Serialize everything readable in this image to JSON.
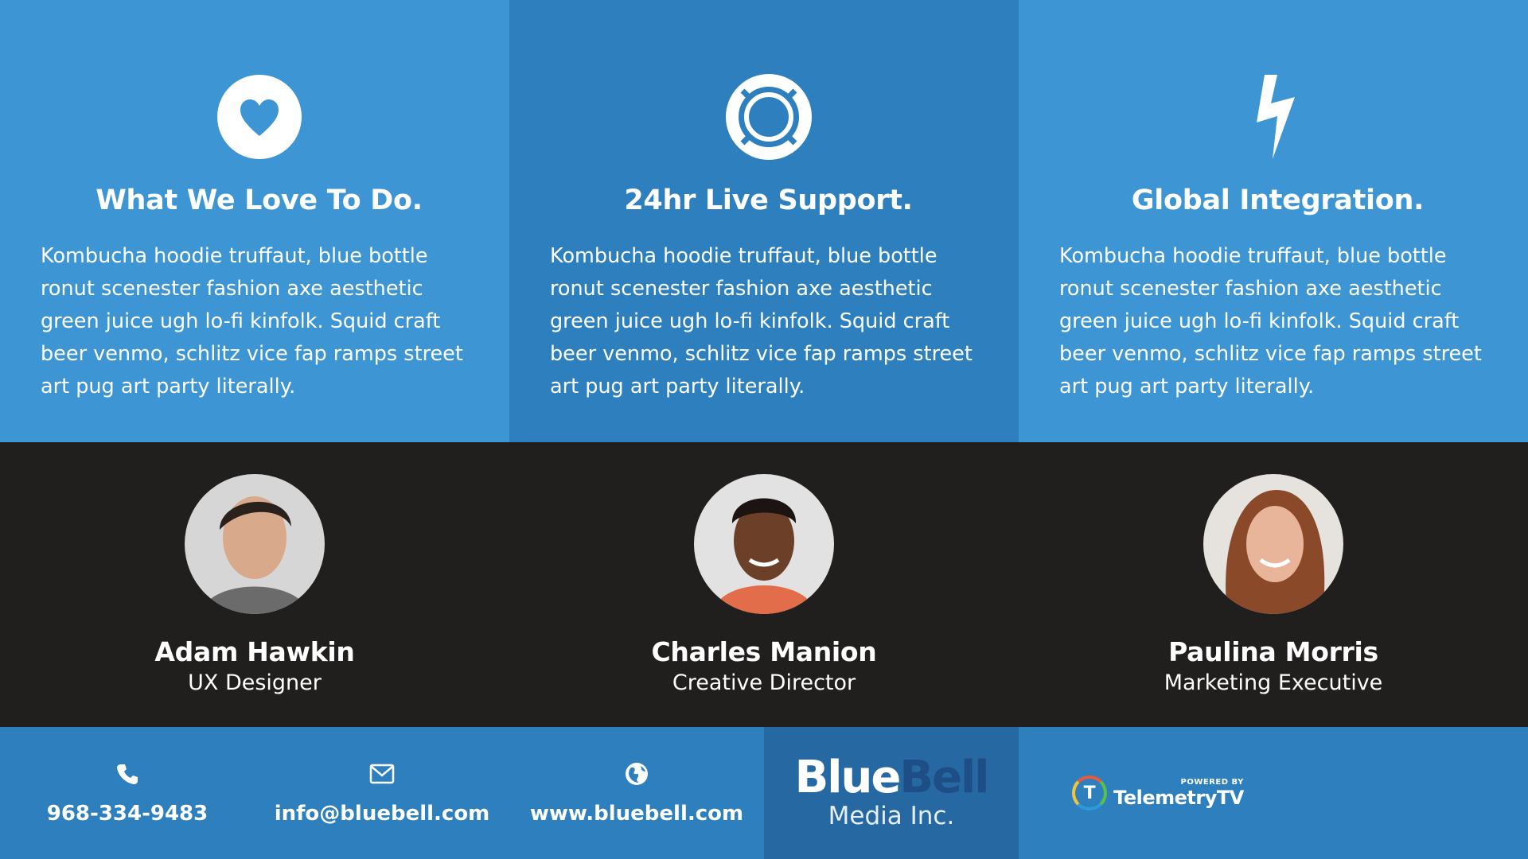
{
  "features": [
    {
      "icon": "heart-circle-icon",
      "title": "What We Love To Do.",
      "body": "Kombucha hoodie truffaut, blue bottle ronut scenester fashion axe aesthetic green juice ugh lo-fi kinfolk. Squid craft beer venmo, schlitz vice fap ramps street art pug art party literally."
    },
    {
      "icon": "lifebuoy-icon",
      "title": "24hr Live Support.",
      "body": "Kombucha hoodie truffaut, blue bottle ronut scenester fashion axe aesthetic green juice ugh lo-fi kinfolk. Squid craft beer venmo, schlitz vice fap ramps street art pug art party literally."
    },
    {
      "icon": "lightning-bolt-icon",
      "title": "Global Integration.",
      "body": "Kombucha hoodie truffaut, blue bottle ronut scenester fashion axe aesthetic green juice ugh lo-fi kinfolk. Squid craft beer venmo, schlitz vice fap ramps street art pug art party literally."
    }
  ],
  "team": [
    {
      "name": "Adam Hawkin",
      "role": "UX Designer"
    },
    {
      "name": "Charles Manion",
      "role": "Creative Director"
    },
    {
      "name": "Paulina Morris",
      "role": "Marketing Executive"
    }
  ],
  "footer": {
    "phone": "968-334-9483",
    "email": "info@bluebell.com",
    "website": "www.bluebell.com",
    "brand_part1": "Blue",
    "brand_part2": "Bell",
    "brand_sub": "Media Inc.",
    "powered_by": "POWERED BY",
    "powered_name": "TelemetryTV",
    "powered_letter": "T"
  },
  "colors": {
    "feature_light": "#3d95d3",
    "feature_dark": "#2d80bd",
    "team_bg": "#211f1d",
    "brand_bg": "#2568a2"
  }
}
